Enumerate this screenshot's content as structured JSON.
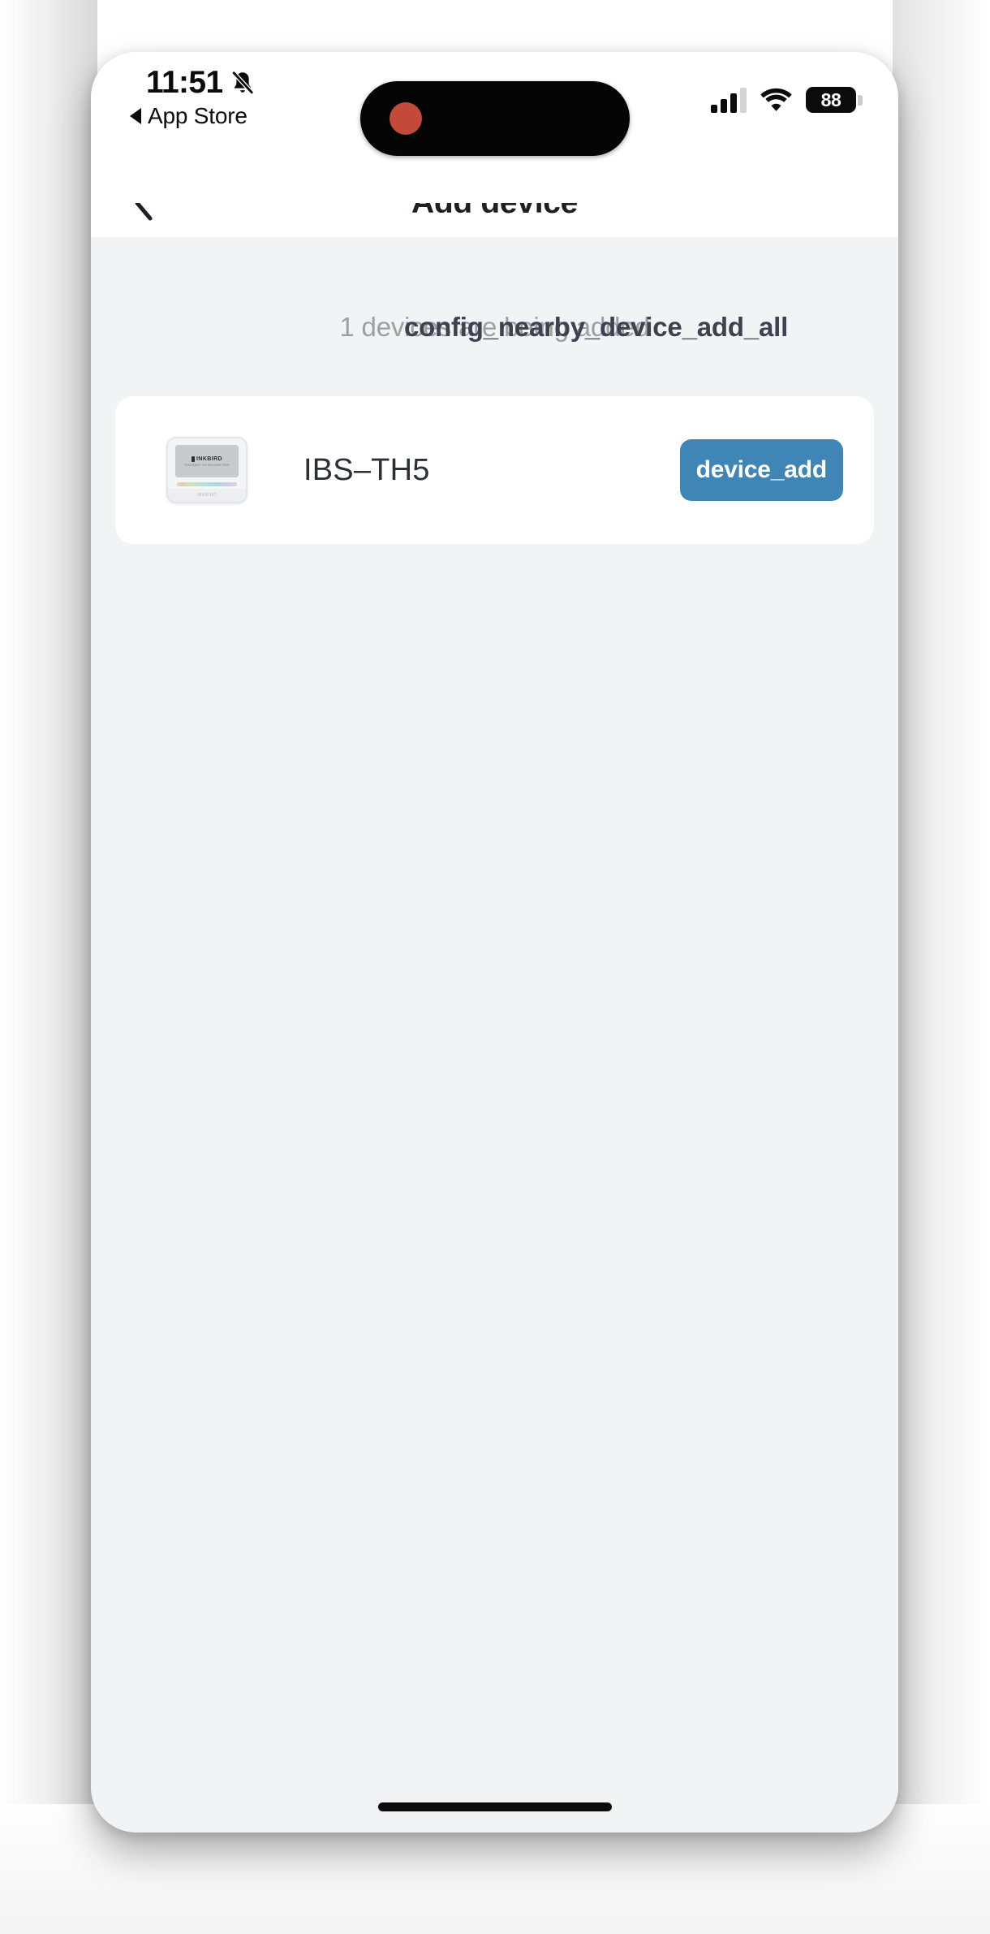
{
  "status_bar": {
    "time": "11:51",
    "silent_icon": "bell-slash-icon",
    "return_app_label": "App Store",
    "return_app_arrow": "back-triangle-icon",
    "recording_indicator": "recording-dot",
    "cellular_icon": "signal-bars-icon",
    "wifi_icon": "wifi-icon",
    "battery_level": "88"
  },
  "nav_bar": {
    "back_icon": "chevron-left-icon",
    "title": "Add device"
  },
  "content": {
    "status_text": "1 devices are being added",
    "overlay_key_text": "config_nearby_device_add_all",
    "device": {
      "thumbnail_icon": "thermometer-device-icon",
      "brand": "INKBIRD",
      "brand_subtitle": "THERMO HYGROMETER",
      "foot_label": "INKBIRD",
      "name": "IBS–TH5",
      "add_button_label": "device_add"
    }
  },
  "home_indicator": "home-indicator",
  "colors": {
    "accent_blue": "#3f85b6",
    "screen_background": "#f2f3f5",
    "card_background": "#ffffff",
    "status_text_gray": "#9d9fa3",
    "overlay_text_dark": "#3c4250",
    "recording_red": "#c34a38"
  }
}
